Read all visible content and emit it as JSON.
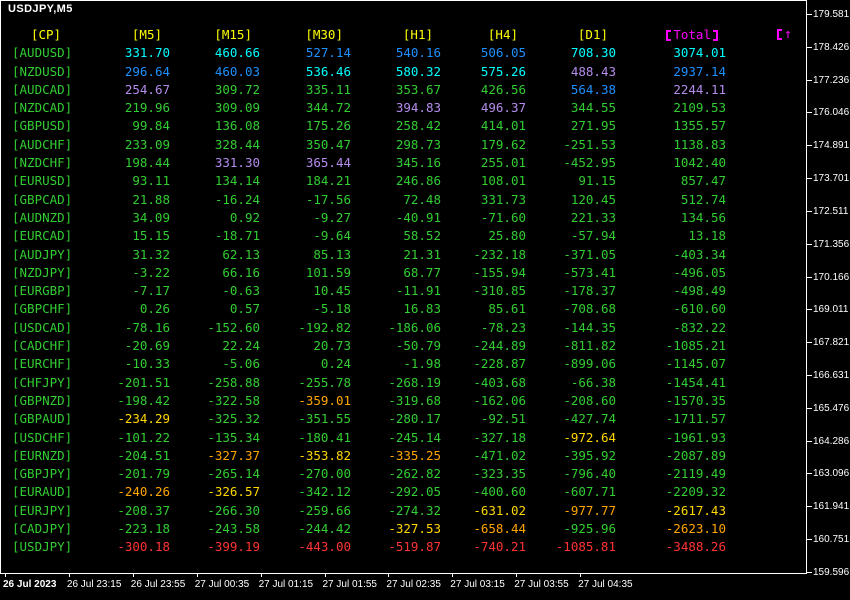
{
  "window": {
    "title": "USDJPY,M5"
  },
  "table": {
    "cp_header": "[CP]",
    "tf_headers": [
      "[M5]",
      "[M15]",
      "[M30]",
      "[H1]",
      "[H4]",
      "[D1]"
    ],
    "total_header": "Total",
    "sort_arrow": "↑",
    "rows": [
      {
        "pair": "[AUDUSD]",
        "values": [
          "331.70",
          "460.66",
          "527.14",
          "540.16",
          "506.05",
          "708.30",
          "3074.01"
        ]
      },
      {
        "pair": "[NZDUSD]",
        "values": [
          "296.64",
          "460.03",
          "536.46",
          "580.32",
          "575.26",
          "488.43",
          "2937.14"
        ]
      },
      {
        "pair": "[AUDCAD]",
        "values": [
          "254.67",
          "309.72",
          "335.11",
          "353.67",
          "426.56",
          "564.38",
          "2244.11"
        ]
      },
      {
        "pair": "[NZDCAD]",
        "values": [
          "219.96",
          "309.09",
          "344.72",
          "394.83",
          "496.37",
          "344.55",
          "2109.53"
        ]
      },
      {
        "pair": "[GBPUSD]",
        "values": [
          "99.84",
          "136.08",
          "175.26",
          "258.42",
          "414.01",
          "271.95",
          "1355.57"
        ]
      },
      {
        "pair": "[AUDCHF]",
        "values": [
          "233.09",
          "328.44",
          "350.47",
          "298.73",
          "179.62",
          "-251.53",
          "1138.83"
        ]
      },
      {
        "pair": "[NZDCHF]",
        "values": [
          "198.44",
          "331.30",
          "365.44",
          "345.16",
          "255.01",
          "-452.95",
          "1042.40"
        ]
      },
      {
        "pair": "[EURUSD]",
        "values": [
          "93.11",
          "134.14",
          "184.21",
          "246.86",
          "108.01",
          "91.15",
          "857.47"
        ]
      },
      {
        "pair": "[GBPCAD]",
        "values": [
          "21.88",
          "-16.24",
          "-17.56",
          "72.48",
          "331.73",
          "120.45",
          "512.74"
        ]
      },
      {
        "pair": "[AUDNZD]",
        "values": [
          "34.09",
          "0.92",
          "-9.27",
          "-40.91",
          "-71.60",
          "221.33",
          "134.56"
        ]
      },
      {
        "pair": "[EURCAD]",
        "values": [
          "15.15",
          "-18.71",
          "-9.64",
          "58.52",
          "25.80",
          "-57.94",
          "13.18"
        ]
      },
      {
        "pair": "[AUDJPY]",
        "values": [
          "31.32",
          "62.13",
          "85.13",
          "21.31",
          "-232.18",
          "-371.05",
          "-403.34"
        ]
      },
      {
        "pair": "[NZDJPY]",
        "values": [
          "-3.22",
          "66.16",
          "101.59",
          "68.77",
          "-155.94",
          "-573.41",
          "-496.05"
        ]
      },
      {
        "pair": "[EURGBP]",
        "values": [
          "-7.17",
          "-0.63",
          "10.45",
          "-11.91",
          "-310.85",
          "-178.37",
          "-498.49"
        ]
      },
      {
        "pair": "[GBPCHF]",
        "values": [
          "0.26",
          "0.57",
          "-5.18",
          "16.83",
          "85.61",
          "-708.68",
          "-610.60"
        ]
      },
      {
        "pair": "[USDCAD]",
        "values": [
          "-78.16",
          "-152.60",
          "-192.82",
          "-186.06",
          "-78.23",
          "-144.35",
          "-832.22"
        ]
      },
      {
        "pair": "[CADCHF]",
        "values": [
          "-20.69",
          "22.24",
          "20.73",
          "-50.79",
          "-244.89",
          "-811.82",
          "-1085.21"
        ]
      },
      {
        "pair": "[EURCHF]",
        "values": [
          "-10.33",
          "-5.06",
          "0.24",
          "-1.98",
          "-228.87",
          "-899.06",
          "-1145.07"
        ]
      },
      {
        "pair": "[CHFJPY]",
        "values": [
          "-201.51",
          "-258.88",
          "-255.78",
          "-268.19",
          "-403.68",
          "-66.38",
          "-1454.41"
        ]
      },
      {
        "pair": "[GBPNZD]",
        "values": [
          "-198.42",
          "-322.58",
          "-359.01",
          "-319.68",
          "-162.06",
          "-208.60",
          "-1570.35"
        ]
      },
      {
        "pair": "[GBPAUD]",
        "values": [
          "-234.29",
          "-325.32",
          "-351.55",
          "-280.17",
          "-92.51",
          "-427.74",
          "-1711.57"
        ]
      },
      {
        "pair": "[USDCHF]",
        "values": [
          "-101.22",
          "-135.34",
          "-180.41",
          "-245.14",
          "-327.18",
          "-972.64",
          "-1961.93"
        ]
      },
      {
        "pair": "[EURNZD]",
        "values": [
          "-204.51",
          "-327.37",
          "-353.82",
          "-335.25",
          "-471.02",
          "-395.92",
          "-2087.89"
        ]
      },
      {
        "pair": "[GBPJPY]",
        "values": [
          "-201.79",
          "-265.14",
          "-270.00",
          "-262.82",
          "-323.35",
          "-796.40",
          "-2119.49"
        ]
      },
      {
        "pair": "[EURAUD]",
        "values": [
          "-240.26",
          "-326.57",
          "-342.12",
          "-292.05",
          "-400.60",
          "-607.71",
          "-2209.32"
        ]
      },
      {
        "pair": "[EURJPY]",
        "values": [
          "-208.37",
          "-266.30",
          "-259.66",
          "-274.32",
          "-631.02",
          "-977.77",
          "-2617.43"
        ]
      },
      {
        "pair": "[CADJPY]",
        "values": [
          "-223.18",
          "-243.58",
          "-244.42",
          "-327.53",
          "-658.44",
          "-925.96",
          "-2623.10"
        ]
      },
      {
        "pair": "[USDJPY]",
        "values": [
          "-300.18",
          "-399.19",
          "-443.00",
          "-519.87",
          "-740.21",
          "-1085.81",
          "-3488.26"
        ]
      }
    ]
  },
  "price_axis": {
    "labels": [
      "179.581",
      "178.426",
      "177.236",
      "176.046",
      "174.891",
      "173.701",
      "172.511",
      "171.356",
      "170.166",
      "169.011",
      "167.821",
      "166.631",
      "165.476",
      "164.286",
      "163.096",
      "161.941",
      "160.751",
      "159.596"
    ]
  },
  "time_axis": {
    "labels": [
      "26 Jul 2023",
      "26 Jul 23:15",
      "26 Jul 23:55",
      "27 Jul 00:35",
      "27 Jul 01:15",
      "27 Jul 01:55",
      "27 Jul 02:35",
      "27 Jul 03:15",
      "27 Jul 03:55",
      "27 Jul 04:35"
    ]
  },
  "colors": {
    "background": "#000000",
    "chart_border": "#FFFFFF",
    "title_text": "#FFFFFF",
    "header_text": "#FFFF00",
    "total_text": "#FF00FF",
    "pair_text": "#32CD32",
    "value_default": "#32CD32",
    "rank1_top": "#00FFFF",
    "rank2_top": "#1E90FF",
    "rank3_top": "#B48CEC",
    "rank3_bottom": "#FFD700",
    "rank2_bottom": "#FFA500",
    "rank1_bottom": "#FF3333",
    "axis_text": "#FFFFFF"
  }
}
